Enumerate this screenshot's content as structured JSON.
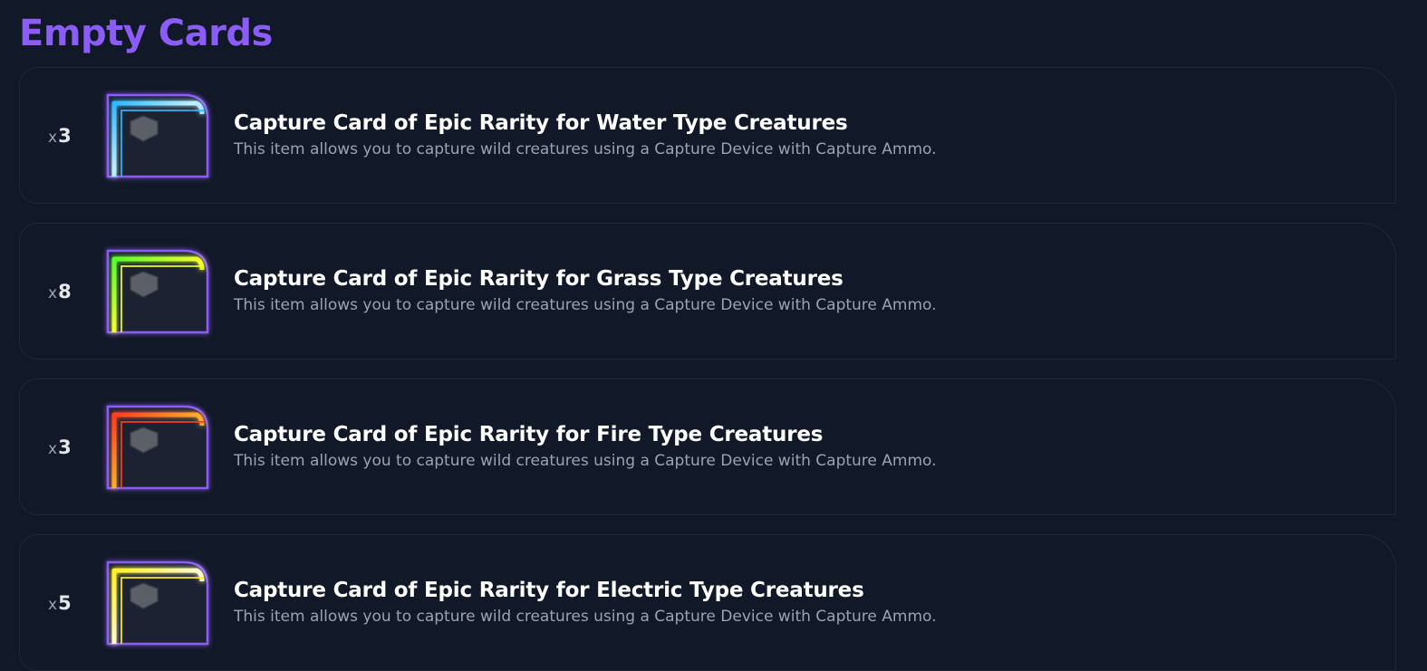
{
  "section": {
    "title": "Empty Cards"
  },
  "items": [
    {
      "qty_prefix": "x",
      "qty": "3",
      "title": "Capture Card of Epic Rarity for Water Type Creatures",
      "description": "This item allows you to capture wild creatures using a Capture Device with Capture Ammo.",
      "icon": "water-capture-card-icon",
      "accent": "#2fb7ff",
      "accent_light": "#bff0ff"
    },
    {
      "qty_prefix": "x",
      "qty": "8",
      "title": "Capture Card of Epic Rarity for Grass Type Creatures",
      "description": "This item allows you to capture wild creatures using a Capture Device with Capture Ammo.",
      "icon": "grass-capture-card-icon",
      "accent": "#55ff28",
      "accent_light": "#f7ff2d"
    },
    {
      "qty_prefix": "x",
      "qty": "3",
      "title": "Capture Card of Epic Rarity for Fire Type Creatures",
      "description": "This item allows you to capture wild creatures using a Capture Device with Capture Ammo.",
      "icon": "fire-capture-card-icon",
      "accent": "#ff3b22",
      "accent_light": "#ffb02e"
    },
    {
      "qty_prefix": "x",
      "qty": "5",
      "title": "Capture Card of Epic Rarity for Electric Type Creatures",
      "description": "This item allows you to capture wild creatures using a Capture Device with Capture Ammo.",
      "icon": "electric-capture-card-icon",
      "accent": "#fff21e",
      "accent_light": "#fffbd0"
    }
  ],
  "colors": {
    "background": "#111827",
    "section_title": "#8b5cf6",
    "card_border": "#8b5cf6",
    "row_border": "#1f2937",
    "muted_text": "#9ca3af"
  }
}
